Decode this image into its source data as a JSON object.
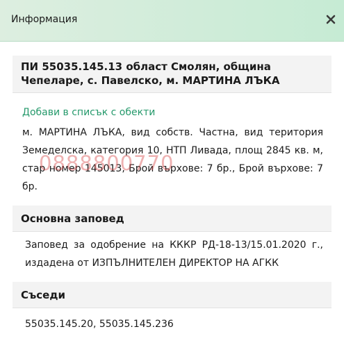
{
  "dialog": {
    "title": "Информация",
    "close_label": "×"
  },
  "property": {
    "heading": "ПИ 55035.145.13 област Смолян, община Чепеларе, с. Павелско, м. МАРТИНА ЛЪКА",
    "add_link": "Добави в списък с обекти",
    "description": "м. МАРТИНА ЛЪКА, вид собств. Частна, вид територия Земеделска, категория 10, НТП Ливада, площ 2845 кв. м, стар номер 145013, Брой върхове: 7 бр., Брой върхове: 7 бр.",
    "watermark": "0888800770"
  },
  "order": {
    "heading": "Основна заповед",
    "text": "Заповед за одобрение на КККР РД-18-13/15.01.2020 г., издадена от ИЗПЪЛНИТЕЛЕН ДИРЕКТОР НА АГКК"
  },
  "neighbors": {
    "heading": "Съседи",
    "text": "55035.145.20, 55035.145.236"
  },
  "colors": {
    "header_bg_start": "#ddeee0",
    "header_bg_end": "#c6ebd4",
    "link": "#25996b",
    "section_bg": "#f3f3f3",
    "watermark": "#d74646"
  }
}
